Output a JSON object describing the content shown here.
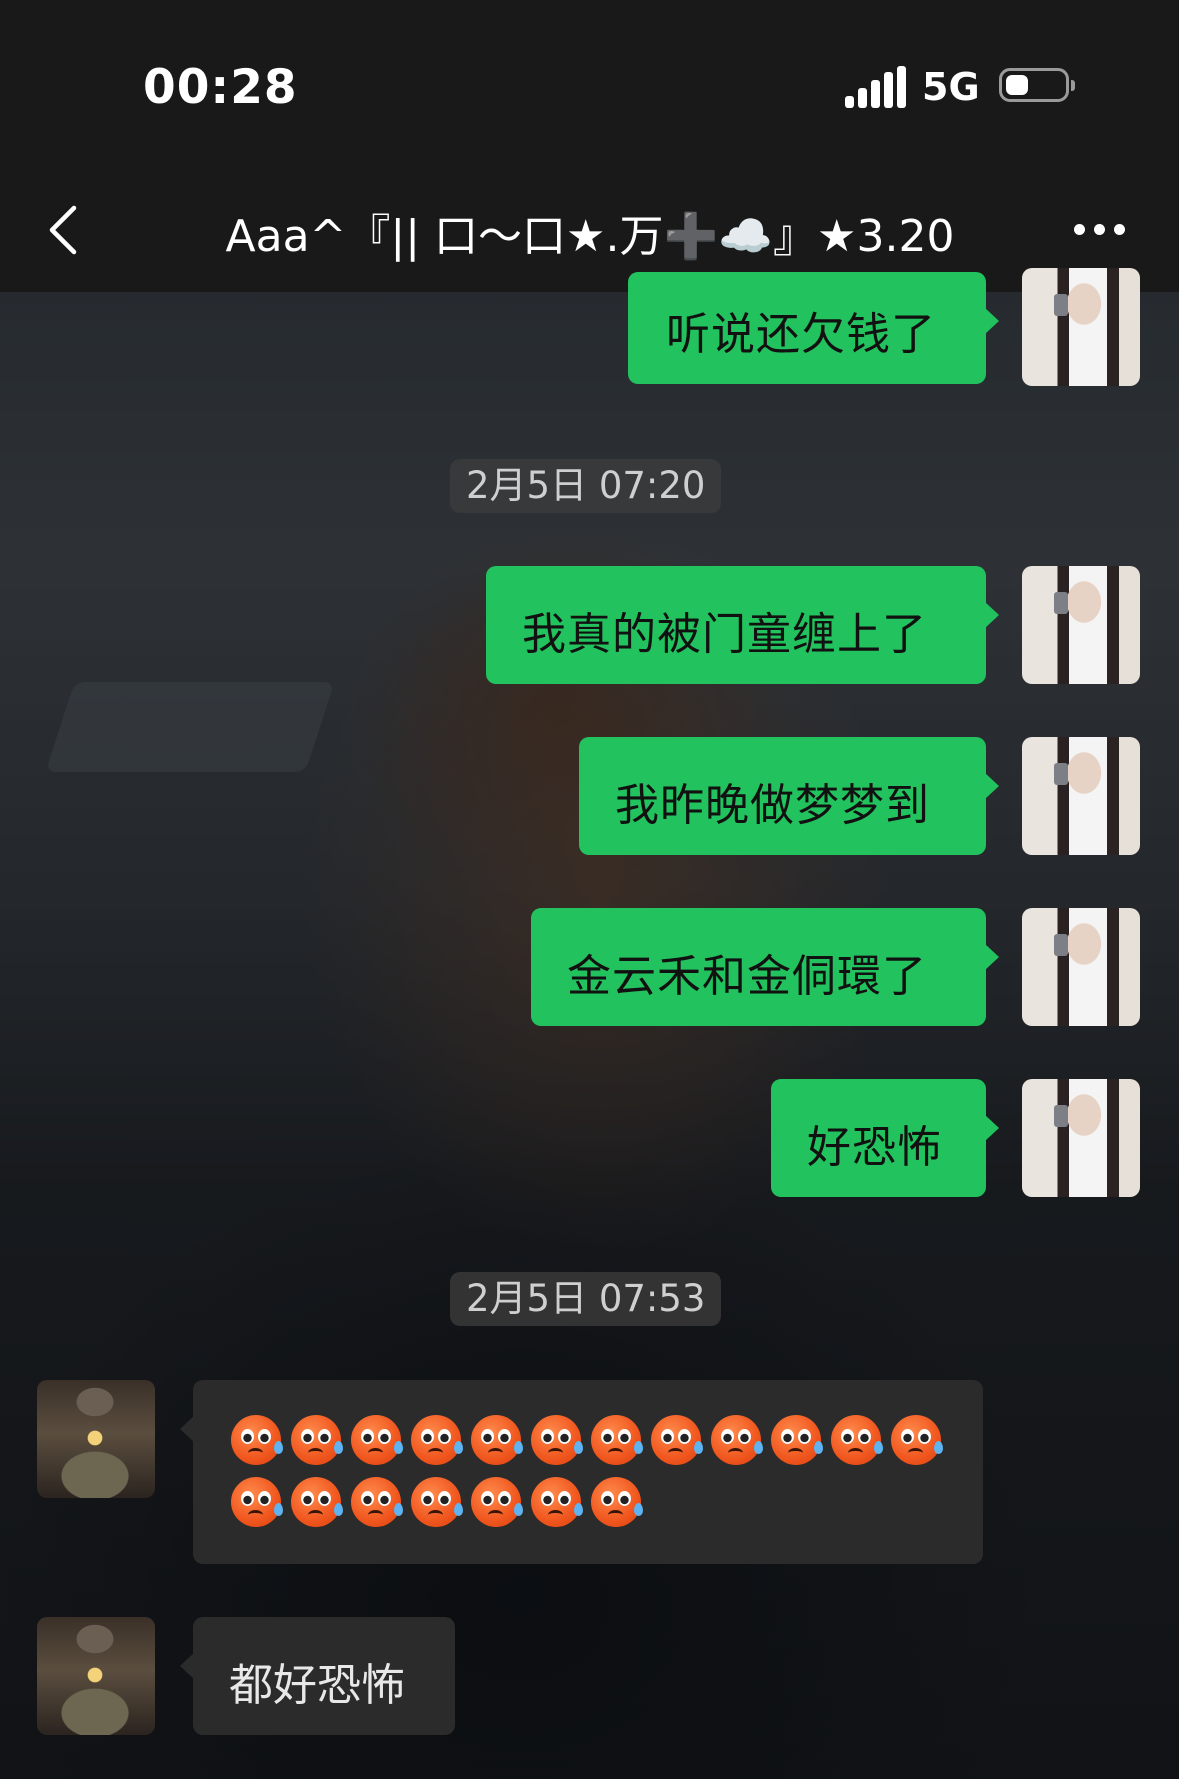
{
  "status_bar": {
    "time": "00:28",
    "network": "5G",
    "battery_level": 0.3
  },
  "nav": {
    "title": "Aaa^『|| 口～口★.万➕☁️』★3.20"
  },
  "messages": [
    {
      "type": "outgoing",
      "text": "听说还欠钱了"
    },
    {
      "type": "timestamp",
      "text": "2月5日 07:20"
    },
    {
      "type": "outgoing",
      "text": "我真的被门童缠上了"
    },
    {
      "type": "outgoing",
      "text": "我昨晚做梦梦到"
    },
    {
      "type": "outgoing",
      "text": "金云禾和金侗環了"
    },
    {
      "type": "outgoing",
      "text": "好恐怖"
    },
    {
      "type": "timestamp",
      "text": "2月5日 07:53"
    },
    {
      "type": "incoming",
      "emoji": "scared-face-emoji",
      "emoji_count": 19
    },
    {
      "type": "incoming",
      "text": "都好恐怖"
    }
  ],
  "colors": {
    "outgoing_bubble": "#22c35e",
    "incoming_bubble": "#2b2b2b",
    "bar": "#191919"
  }
}
